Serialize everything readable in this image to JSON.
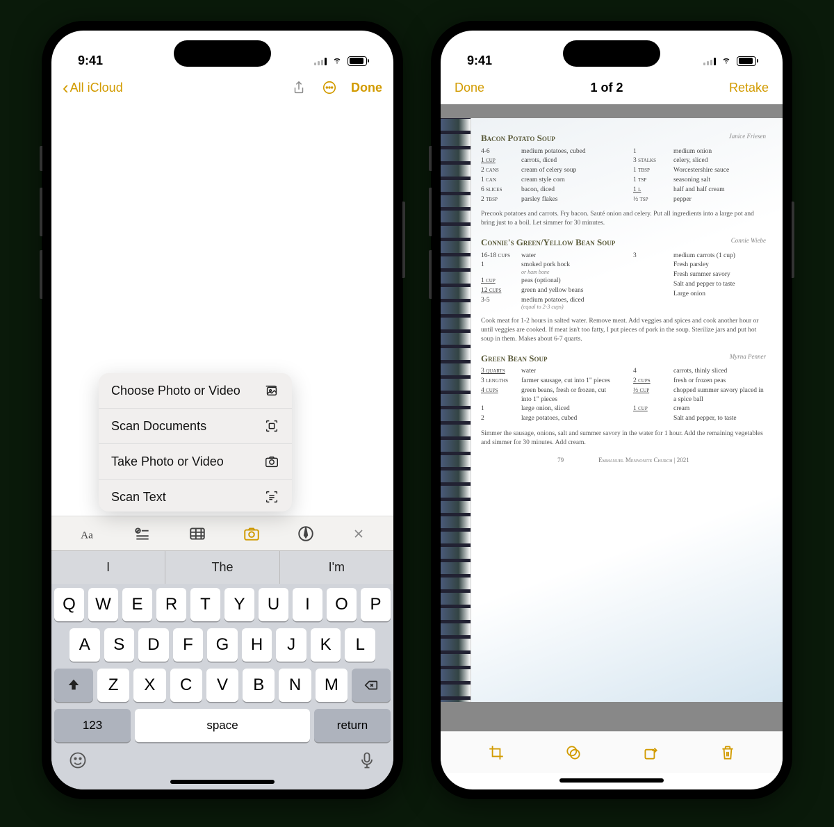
{
  "status": {
    "time": "9:41"
  },
  "left": {
    "nav": {
      "back_label": "All iCloud",
      "done": "Done"
    },
    "menu": {
      "choose": "Choose Photo or Video",
      "scan_docs": "Scan Documents",
      "take": "Take Photo or Video",
      "scan_text": "Scan Text"
    },
    "suggestions": [
      "I",
      "The",
      "I'm"
    ],
    "keyboard": {
      "row1": [
        "Q",
        "W",
        "E",
        "R",
        "T",
        "Y",
        "U",
        "I",
        "O",
        "P"
      ],
      "row2": [
        "A",
        "S",
        "D",
        "F",
        "G",
        "H",
        "J",
        "K",
        "L"
      ],
      "row3": [
        "Z",
        "X",
        "C",
        "V",
        "B",
        "N",
        "M"
      ],
      "num": "123",
      "space": "space",
      "return": "return"
    }
  },
  "right": {
    "nav": {
      "done": "Done",
      "title": "1 of 2",
      "retake": "Retake"
    },
    "page": {
      "recipes": [
        {
          "title": "Bacon Potato Soup",
          "author": "Janice Friesen",
          "left": [
            {
              "amt": "4-6",
              "item": "medium potatoes, cubed"
            },
            {
              "amt": "1 cup",
              "ul": true,
              "item": "carrots, diced"
            },
            {
              "amt": "2 cans",
              "item": "cream of celery soup"
            },
            {
              "amt": "1 can",
              "item": "cream style corn"
            },
            {
              "amt": "6 slices",
              "item": "bacon, diced"
            },
            {
              "amt": "2 tbsp",
              "item": "parsley flakes"
            }
          ],
          "right": [
            {
              "amt": "1",
              "item": "medium onion"
            },
            {
              "amt": "3 stalks",
              "item": "celery, sliced"
            },
            {
              "amt": "1 tbsp",
              "item": "Worcestershire sauce"
            },
            {
              "amt": "1 tsp",
              "item": "seasoning salt"
            },
            {
              "amt": "1 l",
              "ul": true,
              "item": "half and half cream"
            },
            {
              "amt": "½ tsp",
              "item": "pepper"
            }
          ],
          "instructions": "Precook potatoes and carrots. Fry bacon. Sauté onion and celery. Put all ingredients into a large pot and bring just to a boil. Let simmer for 30 minutes."
        },
        {
          "title": "Connie's Green/Yellow Bean Soup",
          "author": "Connie Wiebe",
          "left": [
            {
              "amt": "16-18 cups",
              "item": "water"
            },
            {
              "amt": "1",
              "item": "smoked pork hock",
              "note": "or ham bone"
            },
            {
              "amt": "1 cup",
              "ul": true,
              "item": "peas (optional)"
            },
            {
              "amt": "12 cups",
              "ul": true,
              "item": "green and yellow beans"
            },
            {
              "amt": "3-5",
              "item": "medium potatoes, diced",
              "note": "(equal to 2-3 cups)"
            }
          ],
          "right": [
            {
              "amt": "3",
              "item": "medium carrots (1 cup)"
            },
            {
              "amt": "",
              "item": "Fresh parsley"
            },
            {
              "amt": "",
              "item": "Fresh summer savory"
            },
            {
              "amt": "",
              "item": "Salt and pepper to taste"
            },
            {
              "amt": "",
              "item": "Large onion"
            }
          ],
          "instructions": "Cook meat for 1-2 hours in salted water. Remove meat. Add veggies and spices and cook another hour or until veggies are cooked. If meat isn't too fatty, I put pieces of pork in the soup. Sterilize jars and put hot soup in them. Makes about 6-7 quarts."
        },
        {
          "title": "Green Bean Soup",
          "author": "Myrna Penner",
          "left": [
            {
              "amt": "3 quarts",
              "ul": true,
              "item": "water"
            },
            {
              "amt": "3 lengths",
              "item": "farmer sausage, cut into 1\" pieces"
            },
            {
              "amt": "4 cups",
              "ul": true,
              "item": "green beans, fresh or frozen, cut into 1\" pieces"
            },
            {
              "amt": "1",
              "item": "large onion, sliced"
            },
            {
              "amt": "2",
              "item": "large potatoes, cubed"
            }
          ],
          "right": [
            {
              "amt": "4",
              "item": "carrots, thinly sliced"
            },
            {
              "amt": "2 cups",
              "ul": true,
              "item": "fresh or frozen peas"
            },
            {
              "amt": "½ cup",
              "ul": true,
              "item": "chopped summer savory placed in a spice ball"
            },
            {
              "amt": "1 cup",
              "ul": true,
              "item": "cream"
            },
            {
              "amt": "",
              "item": "Salt and pepper, to taste"
            }
          ],
          "instructions": "Simmer the sausage, onions, salt and summer savory in the water for 1 hour. Add the remaining vegetables and simmer for 30 minutes. Add cream."
        }
      ],
      "footer": {
        "page": "79",
        "church": "Emmanuel Mennonite Church | 2021"
      }
    }
  }
}
